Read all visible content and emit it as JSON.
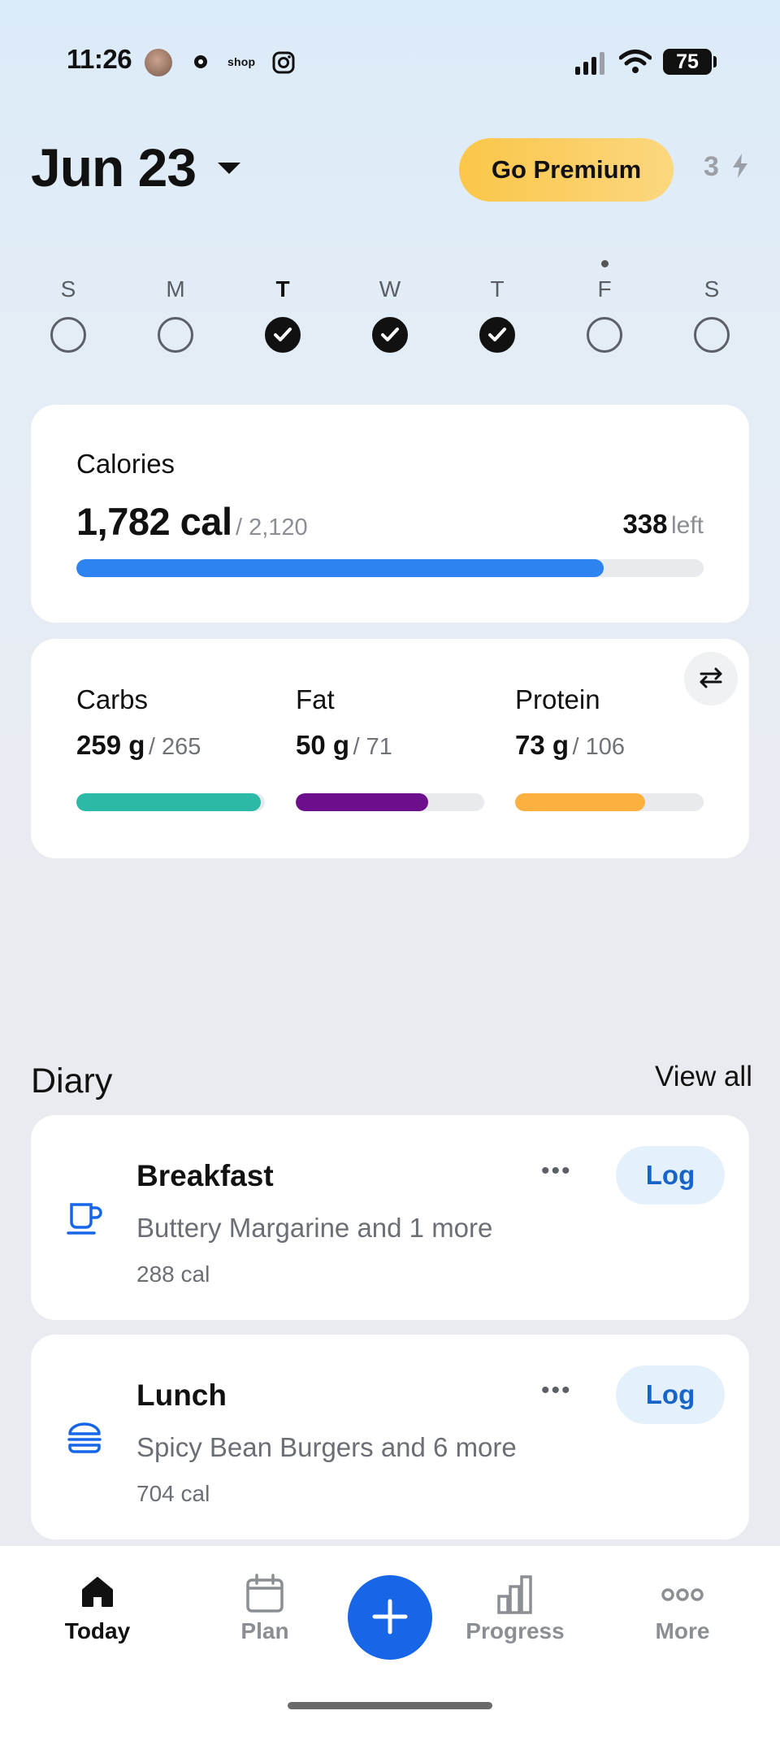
{
  "status_bar": {
    "time": "11:26",
    "shop_label": "shop",
    "battery": "75"
  },
  "header": {
    "date": "Jun 23",
    "premium_label": "Go Premium",
    "streak_count": "3"
  },
  "week": {
    "days": [
      {
        "letter": "S",
        "done": false,
        "current": false
      },
      {
        "letter": "M",
        "done": false,
        "current": false
      },
      {
        "letter": "T",
        "done": true,
        "current": true
      },
      {
        "letter": "W",
        "done": true,
        "current": false
      },
      {
        "letter": "T",
        "done": true,
        "current": false
      },
      {
        "letter": "F",
        "done": false,
        "current": false
      },
      {
        "letter": "S",
        "done": false,
        "current": false
      }
    ]
  },
  "calories": {
    "label": "Calories",
    "consumed": "1,782 cal",
    "goal": "/ 2,120",
    "left_value": "338",
    "left_word": "left",
    "progress": 0.841,
    "color": "#2d84f1"
  },
  "macros": [
    {
      "name": "Carbs",
      "value": "259 g",
      "goal": "/ 265",
      "progress": 0.977,
      "color": "#2cb9a5"
    },
    {
      "name": "Fat",
      "value": "50 g",
      "goal": "/ 71",
      "progress": 0.704,
      "color": "#6d0f8c"
    },
    {
      "name": "Protein",
      "value": "73 g",
      "goal": "/ 106",
      "progress": 0.689,
      "color": "#fbb040"
    }
  ],
  "diary": {
    "title": "Diary",
    "view_all": "View all",
    "meals": [
      {
        "title": "Breakfast",
        "desc": "Buttery Margarine and 1 more",
        "cal": "288 cal",
        "log": "Log",
        "icon": "coffee-cup-icon"
      },
      {
        "title": "Lunch",
        "desc": "Spicy Bean Burgers and 6 more",
        "cal": "704 cal",
        "log": "Log",
        "icon": "burger-icon"
      }
    ]
  },
  "nav": {
    "today": "Today",
    "plan": "Plan",
    "progress": "Progress",
    "more": "More"
  }
}
